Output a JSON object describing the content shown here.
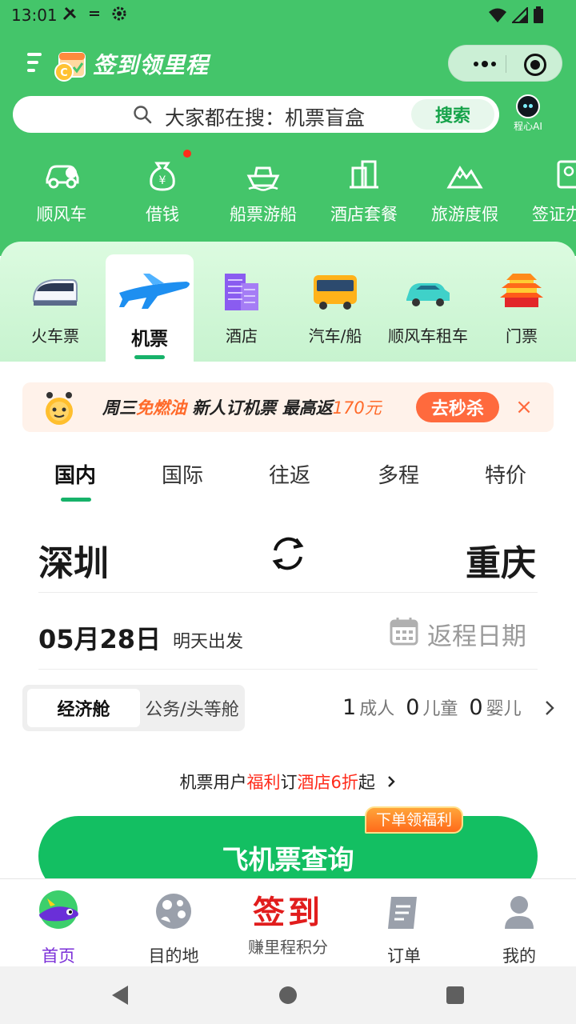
{
  "status_bar": {
    "time": "13:01"
  },
  "header": {
    "title": "签到领里程"
  },
  "search": {
    "hint": "大家都在搜：机票盲盒",
    "button": "搜索",
    "ai_label": "程心AI"
  },
  "services": [
    {
      "label": "顺风车",
      "icon": "car-icon"
    },
    {
      "label": "借钱",
      "icon": "money-bag-icon"
    },
    {
      "label": "船票游船",
      "icon": "ship-icon"
    },
    {
      "label": "酒店套餐",
      "icon": "building-icon"
    },
    {
      "label": "旅游度假",
      "icon": "mountain-icon"
    },
    {
      "label": "签证办",
      "icon": "passport-icon"
    }
  ],
  "transport_tabs": [
    {
      "label": "火车票",
      "icon": "train-icon"
    },
    {
      "label": "机票",
      "icon": "airplane-icon",
      "active": true
    },
    {
      "label": "酒店",
      "icon": "hotel-icon"
    },
    {
      "label": "汽车/船",
      "icon": "bus-icon"
    },
    {
      "label": "顺风车租车",
      "icon": "car-icon"
    },
    {
      "label": "门票",
      "icon": "temple-icon"
    }
  ],
  "promo": {
    "prefix": "周三",
    "highlight": "免燃油",
    "middle": " 新人订机票 最高返",
    "amount": "170元",
    "button": "去秒杀"
  },
  "flight_modes": [
    "国内",
    "国际",
    "往返",
    "多程",
    "特价"
  ],
  "route": {
    "from": "深圳",
    "to": "重庆"
  },
  "dates": {
    "depart": "05月28日",
    "depart_hint": "明天出发",
    "return_placeholder": "返程日期"
  },
  "cabin": {
    "selected": "经济舱",
    "other": "公务/头等舱"
  },
  "passengers": {
    "adults": "1",
    "adults_label": "成人",
    "children": "0",
    "children_label": "儿童",
    "infants": "0",
    "infants_label": "婴儿"
  },
  "benefit": {
    "p1": "机票用户",
    "p2": "福利",
    "p3": "订",
    "p4": "酒店6折",
    "p5": "起"
  },
  "search_button": {
    "label": "飞机票查询",
    "badge": "下单领福利"
  },
  "bottom_nav": {
    "home": "首页",
    "destination": "目的地",
    "checkin_big": "签到",
    "checkin": "赚里程积分",
    "orders": "订单",
    "mine": "我的"
  },
  "colors": {
    "brand_green": "#44c56a",
    "button_green": "#13bf62",
    "promo_orange": "#ff6a3d",
    "active_purple": "#7b2fd8"
  }
}
